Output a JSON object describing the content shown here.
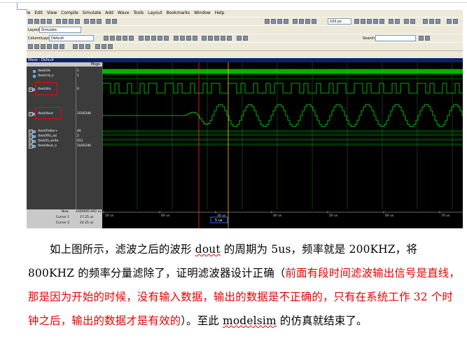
{
  "menu": [
    "le",
    "Edit",
    "View",
    "Compile",
    "Simulate",
    "Add",
    "Wave",
    "Tools",
    "Layout",
    "Bookmarks",
    "Window",
    "Help"
  ],
  "toolbar": {
    "layout_label": "Layout",
    "layout_value": "Simulate",
    "column_layout_label": "ColumnLayout",
    "column_layout_value": "Default",
    "zoom_value": "100 ps",
    "search_label": "Search:"
  },
  "wave": {
    "title": "Wave - Default",
    "msgs_header": "Msgs",
    "signals": [
      {
        "name": "/test/clk",
        "value": "1"
      },
      {
        "name": "/test/rst_n",
        "value": "1"
      },
      {
        "name": "/test/din",
        "value": "0"
      },
      {
        "name": "/test/dout",
        "value": "1026346"
      },
      {
        "name": "/test/Fetter+",
        "value": "46"
      },
      {
        "name": "/test/fifo_ad",
        "value": "2"
      },
      {
        "name": "/test/fo_write",
        "value": "011"
      },
      {
        "name": "/test/dout_o",
        "value": "1026346"
      }
    ],
    "now_label": "Now",
    "now_value": "1000005.002 us",
    "cursor1_label": "Cursor 1",
    "cursor1_value": "17.25 us",
    "cursor2_label": "Cursor 2",
    "cursor2_value": "22.25 us",
    "delta_label": "5 us",
    "timeline_ticks": [
      "50 us",
      "60 us",
      "30 us",
      "40 us",
      "50 us",
      "60 us",
      "70 us"
    ]
  },
  "text": {
    "p1": "如上图所示，滤波之后的波形 ",
    "dout": "dout",
    "p2": " 的周期为 5us，频率就是 200KHZ，将 800KHZ 的频率分量滤除了，证明滤波器设计正确（",
    "red": "前面有段时间滤波输出信号是直线，那是因为开始的时候，没有输入数据，输出的数据是不正确的，只有在系统工作 32 个时钟之后，输出的数据才是有效的",
    "p3": "）。至此 ",
    "modelsim": "modelsim",
    "p4": " 的仿真就结束了。"
  }
}
